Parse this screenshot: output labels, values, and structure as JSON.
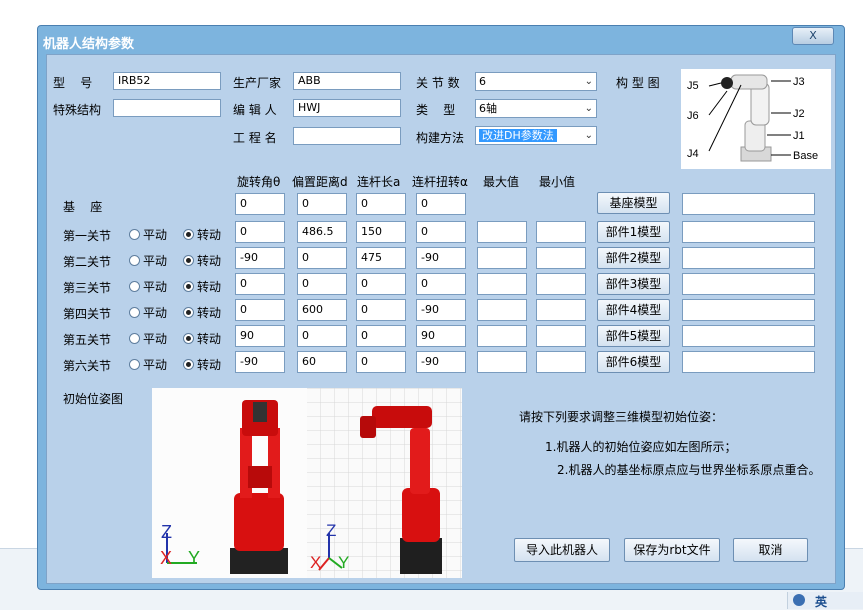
{
  "dialog": {
    "title": "机器人结构参数",
    "close": "X"
  },
  "top": {
    "model_label": "型    号",
    "model_value": "IRB52",
    "special_label": "特殊结构",
    "special_value": "",
    "maker_label": "生产厂家",
    "maker_value": "ABB",
    "editor_label": "编 辑 人",
    "editor_value": "HWJ",
    "project_label": "工 程 名",
    "project_value": "",
    "joints_label": "关 节 数",
    "joints_value": "6",
    "type_label": "类    型",
    "type_value": "6轴",
    "method_label": "构建方法",
    "method_value": "改进DH参数法",
    "diagram_label": "构 型 图"
  },
  "diagram_labels": {
    "j1": "J1",
    "j2": "J2",
    "j3": "J3",
    "j4": "J4",
    "j5": "J5",
    "j6": "J6",
    "base": "Base"
  },
  "headers": [
    "旋转角θ",
    "偏置距离d",
    "连杆长a",
    "连杆扭转α",
    "最大值",
    "最小值"
  ],
  "base": {
    "label": "基    座",
    "values": [
      "0",
      "0",
      "0",
      "0"
    ],
    "button": "基座模型",
    "path": ""
  },
  "radio_labels": {
    "prismatic": "平动",
    "revolute": "转动"
  },
  "joints": [
    {
      "label": "第一关节",
      "theta": "0",
      "d": "486.5",
      "a": "150",
      "alpha": "0",
      "max": "",
      "min": "",
      "button": "部件1模型",
      "path": ""
    },
    {
      "label": "第二关节",
      "theta": "-90",
      "d": "0",
      "a": "475",
      "alpha": "-90",
      "max": "",
      "min": "",
      "button": "部件2模型",
      "path": ""
    },
    {
      "label": "第三关节",
      "theta": "0",
      "d": "0",
      "a": "0",
      "alpha": "0",
      "max": "",
      "min": "",
      "button": "部件3模型",
      "path": ""
    },
    {
      "label": "第四关节",
      "theta": "0",
      "d": "600",
      "a": "0",
      "alpha": "-90",
      "max": "",
      "min": "",
      "button": "部件4模型",
      "path": ""
    },
    {
      "label": "第五关节",
      "theta": "90",
      "d": "0",
      "a": "0",
      "alpha": "90",
      "max": "",
      "min": "",
      "button": "部件5模型",
      "path": ""
    },
    {
      "label": "第六关节",
      "theta": "-90",
      "d": "60",
      "a": "0",
      "alpha": "-90",
      "max": "",
      "min": "",
      "button": "部件6模型",
      "path": ""
    }
  ],
  "pose": {
    "label": "初始位姿图",
    "axes": {
      "z": "Z",
      "x": "X",
      "y": "Y"
    },
    "instructions": "请按下列要求调整三维模型初始位姿：",
    "req1": "1.机器人的初始位姿应如左图所示；",
    "req2": "2.机器人的基坐标原点应与世界坐标系原点重合。"
  },
  "buttons": {
    "import": "导入此机器人",
    "save": "保存为rbt文件",
    "cancel": "取消"
  },
  "taskbar": {
    "ime": "英"
  }
}
